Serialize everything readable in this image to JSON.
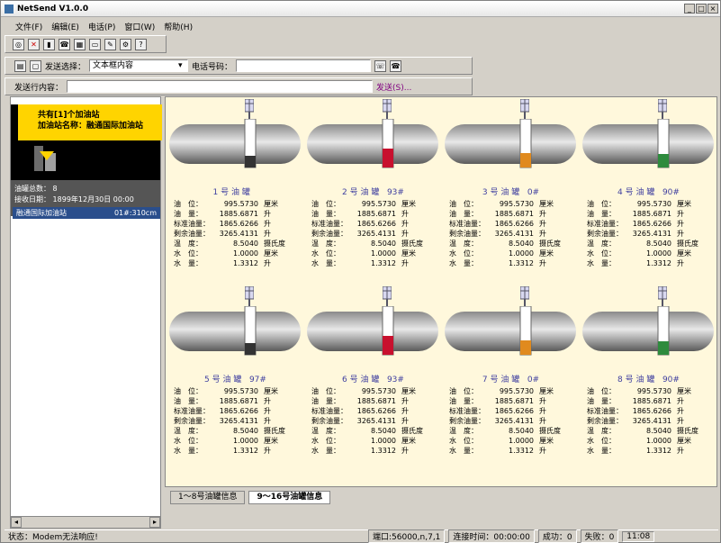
{
  "window": {
    "title": "NetSend V1.0.0"
  },
  "menu": {
    "items": [
      "文件(F)",
      "编辑(E)",
      "电话(P)",
      "窗口(W)",
      "帮助(H)"
    ]
  },
  "toolbar2": {
    "send_select_label": "发送选择：",
    "send_select_value": "文本框内容",
    "phone_label": "电话号码：",
    "phone_value": ""
  },
  "toolbar3": {
    "send_line_label": "发送行内容：",
    "send_button": "发送(S)..."
  },
  "sidebar": {
    "header_line1": "共有[1]个加油站",
    "header_line2": "加油站名称：融通国际加油站",
    "tank_count_label": "油罐总数：",
    "tank_count_value": "8",
    "receive_date_label": "接收日期：",
    "receive_date_value": "1899年12月30日 00:00",
    "item_name": "融通国际加油站",
    "item_meta": "01#:310cm"
  },
  "tanks": [
    {
      "name": "1 号 油 罐",
      "suffix": "",
      "color": "#333333",
      "level": 0.25
    },
    {
      "name": "2 号 油 罐",
      "suffix": "93#",
      "color": "#c8102e",
      "level": 0.4
    },
    {
      "name": "3 号 油 罐",
      "suffix": "0#",
      "color": "#e08a1e",
      "level": 0.3
    },
    {
      "name": "4 号 油 罐",
      "suffix": "90#",
      "color": "#2e8b3d",
      "level": 0.28
    },
    {
      "name": "5 号 油 罐",
      "suffix": "97#",
      "color": "#333333",
      "level": 0.25
    },
    {
      "name": "6 号 油 罐",
      "suffix": "93#",
      "color": "#c8102e",
      "level": 0.4
    },
    {
      "name": "7 号 油 罐",
      "suffix": "0#",
      "color": "#e08a1e",
      "level": 0.3
    },
    {
      "name": "8 号 油 罐",
      "suffix": "90#",
      "color": "#2e8b3d",
      "level": 0.28
    }
  ],
  "tank_rows": [
    {
      "k": "油　位：",
      "v": "995.5730",
      "u": "厘米"
    },
    {
      "k": "油　量：",
      "v": "1885.6871",
      "u": "升"
    },
    {
      "k": "标准油量：",
      "v": "1865.6266",
      "u": "升"
    },
    {
      "k": "剩余油量：",
      "v": "3265.4131",
      "u": "升"
    },
    {
      "k": "温　度：",
      "v": "8.5040",
      "u": "摄氏度"
    },
    {
      "k": "水　位：",
      "v": "1.0000",
      "u": "厘米"
    },
    {
      "k": "水　量：",
      "v": "1.3312",
      "u": "升"
    }
  ],
  "tabs": [
    "1～8号油罐信息",
    "9～16号油罐信息"
  ],
  "statusbar": {
    "status": "状态：Modem无法响应!",
    "port": "端口:56000,n,7,1",
    "connect_time": "连接时间：00:00:00",
    "success": "成功：0",
    "fail": "失败：0",
    "clock": "11:08"
  }
}
